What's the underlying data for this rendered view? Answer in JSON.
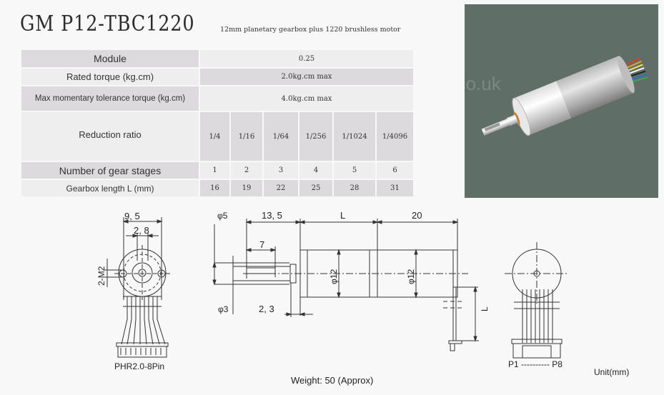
{
  "header": {
    "model": "GM P12-TBC1220",
    "description": "12mm planetary gearbox plus 1220 brushless motor"
  },
  "spec_table": {
    "module": {
      "label": "Module",
      "value": "0.25"
    },
    "rated_torque": {
      "label": "Rated torque (kg.cm)",
      "value": "2.0kg.cm max"
    },
    "max_torque": {
      "label": "Max momentary tolerance torque (kg.cm)",
      "value": "4.0kg.cm max"
    },
    "reduction_ratio": {
      "label": "Reduction ratio",
      "values": [
        "1/4",
        "1/16",
        "1/64",
        "1/256",
        "1/1024",
        "1/4096"
      ]
    },
    "gear_stages": {
      "label": "Number of gear stages",
      "values": [
        "1",
        "2",
        "3",
        "4",
        "5",
        "6"
      ]
    },
    "gearbox_length": {
      "label": "Gearbox length  L (mm)",
      "values": [
        "16",
        "19",
        "22",
        "25",
        "28",
        "31"
      ]
    }
  },
  "photo": {
    "watermark": "Skysmotor.co.uk",
    "background_color": "#5f6e66"
  },
  "drawing": {
    "front_view": {
      "dim_outer": "9, 5",
      "dim_inner": "2, 8",
      "dim_holes": "2-M2",
      "connector": "PHR2.0-8Pin"
    },
    "side_view": {
      "dim_shaft_dia_outer": "φ5",
      "dim_shaft_dia": "φ3",
      "dim_shaft_length": "13, 5",
      "dim_flat": "7",
      "dim_collar": "2, 3",
      "dim_gearbox": "L",
      "dim_motor": "20",
      "dim_gearbox_dia": "φ12",
      "dim_motor_dia": "φ12",
      "dim_lead": "L"
    },
    "rear_view": {
      "pin_range": "P1 ---------- P8"
    },
    "weight": "Weight: 50 (Approx)",
    "unit": "Unit(mm)"
  }
}
